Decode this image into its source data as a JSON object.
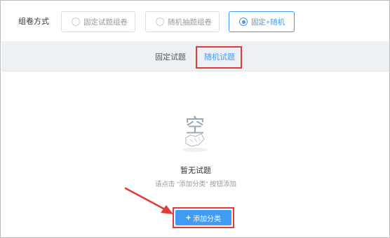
{
  "form": {
    "label": "组卷方式",
    "options": [
      {
        "label": "固定试题组卷",
        "selected": false
      },
      {
        "label": "随机抽题组卷",
        "selected": false
      },
      {
        "label": "固定+随机",
        "selected": true
      }
    ]
  },
  "tabs": [
    {
      "label": "固定试题",
      "active": false
    },
    {
      "label": "随机试题",
      "active": true
    }
  ],
  "empty": {
    "icon_char": "空",
    "title": "暂无试题",
    "hint": "请点击 “添加分类” 按钮添加"
  },
  "add_button": {
    "icon": "+",
    "label": "添加分类"
  },
  "colors": {
    "accent": "#3f9bf3",
    "highlight": "#e23a3a",
    "tabbar_bg": "#eef1f4"
  },
  "icons": {
    "empty_state": "empty-box-icon",
    "arrow": "red-arrow-icon",
    "plus": "plus-icon"
  }
}
